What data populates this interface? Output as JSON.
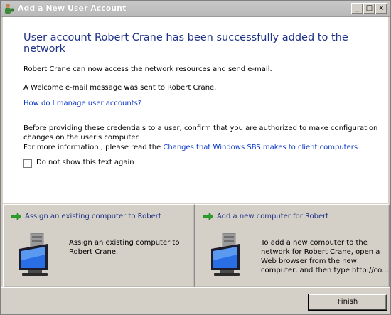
{
  "window": {
    "title": "Add a New User Account",
    "controls": {
      "minimize": "_",
      "maximize": "□",
      "close": "×"
    }
  },
  "main": {
    "headline": "User account Robert Crane has been successfully added to the network",
    "line1": "Robert Crane can now access the network resources and send e-mail.",
    "line2": "A Welcome e-mail message was sent to Robert Crane.",
    "manage_link": "How do I manage user accounts?",
    "notice_line1": "Before providing these credentials to a user, confirm that you are authorized to make configuration",
    "notice_line2": "changes on the user's computer.",
    "more_info_prefix": "For more information , please read the ",
    "more_info_link": "Changes that Windows SBS makes to client computers",
    "checkbox_label": "Do not show this text again",
    "checkbox_checked": false
  },
  "tasks": [
    {
      "title": "Assign an existing computer to Robert",
      "desc_line1": "Assign an existing computer to",
      "desc_line2": "Robert Crane."
    },
    {
      "title": "Add a new computer for Robert",
      "desc_line1": "To add a new computer to the",
      "desc_line2": "network for Robert Crane, open a",
      "desc_line3": "Web browser from the new",
      "desc_line4": "computer, and then type http://co..."
    }
  ],
  "footer": {
    "finish_label": "Finish"
  },
  "colors": {
    "headline": "#1e3287",
    "link": "#0a37c8",
    "arrow": "#2ea02e",
    "window_bg": "#d4d0c8"
  },
  "icons": [
    "user-add-icon",
    "green-arrow-icon",
    "computer-monitor-icon"
  ]
}
